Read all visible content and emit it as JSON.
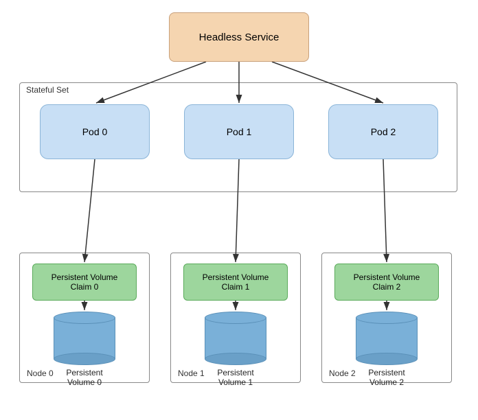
{
  "headless_service": {
    "label": "Headless Service"
  },
  "stateful_set": {
    "label": "Stateful Set"
  },
  "pods": [
    {
      "label": "Pod 0"
    },
    {
      "label": "Pod 1"
    },
    {
      "label": "Pod 2"
    }
  ],
  "pvcs": [
    {
      "label": "Persistent Volume\nClaim 0"
    },
    {
      "label": "Persistent Volume\nClaim 1"
    },
    {
      "label": "Persistent Volume\nClaim 2"
    }
  ],
  "pvs": [
    {
      "label": "Persistent\nVolume 0"
    },
    {
      "label": "Persistent\nVolume 1"
    },
    {
      "label": "Persistent\nVolume 2"
    }
  ],
  "nodes": [
    {
      "label": "Node 0"
    },
    {
      "label": "Node 1"
    },
    {
      "label": "Node 2"
    }
  ]
}
